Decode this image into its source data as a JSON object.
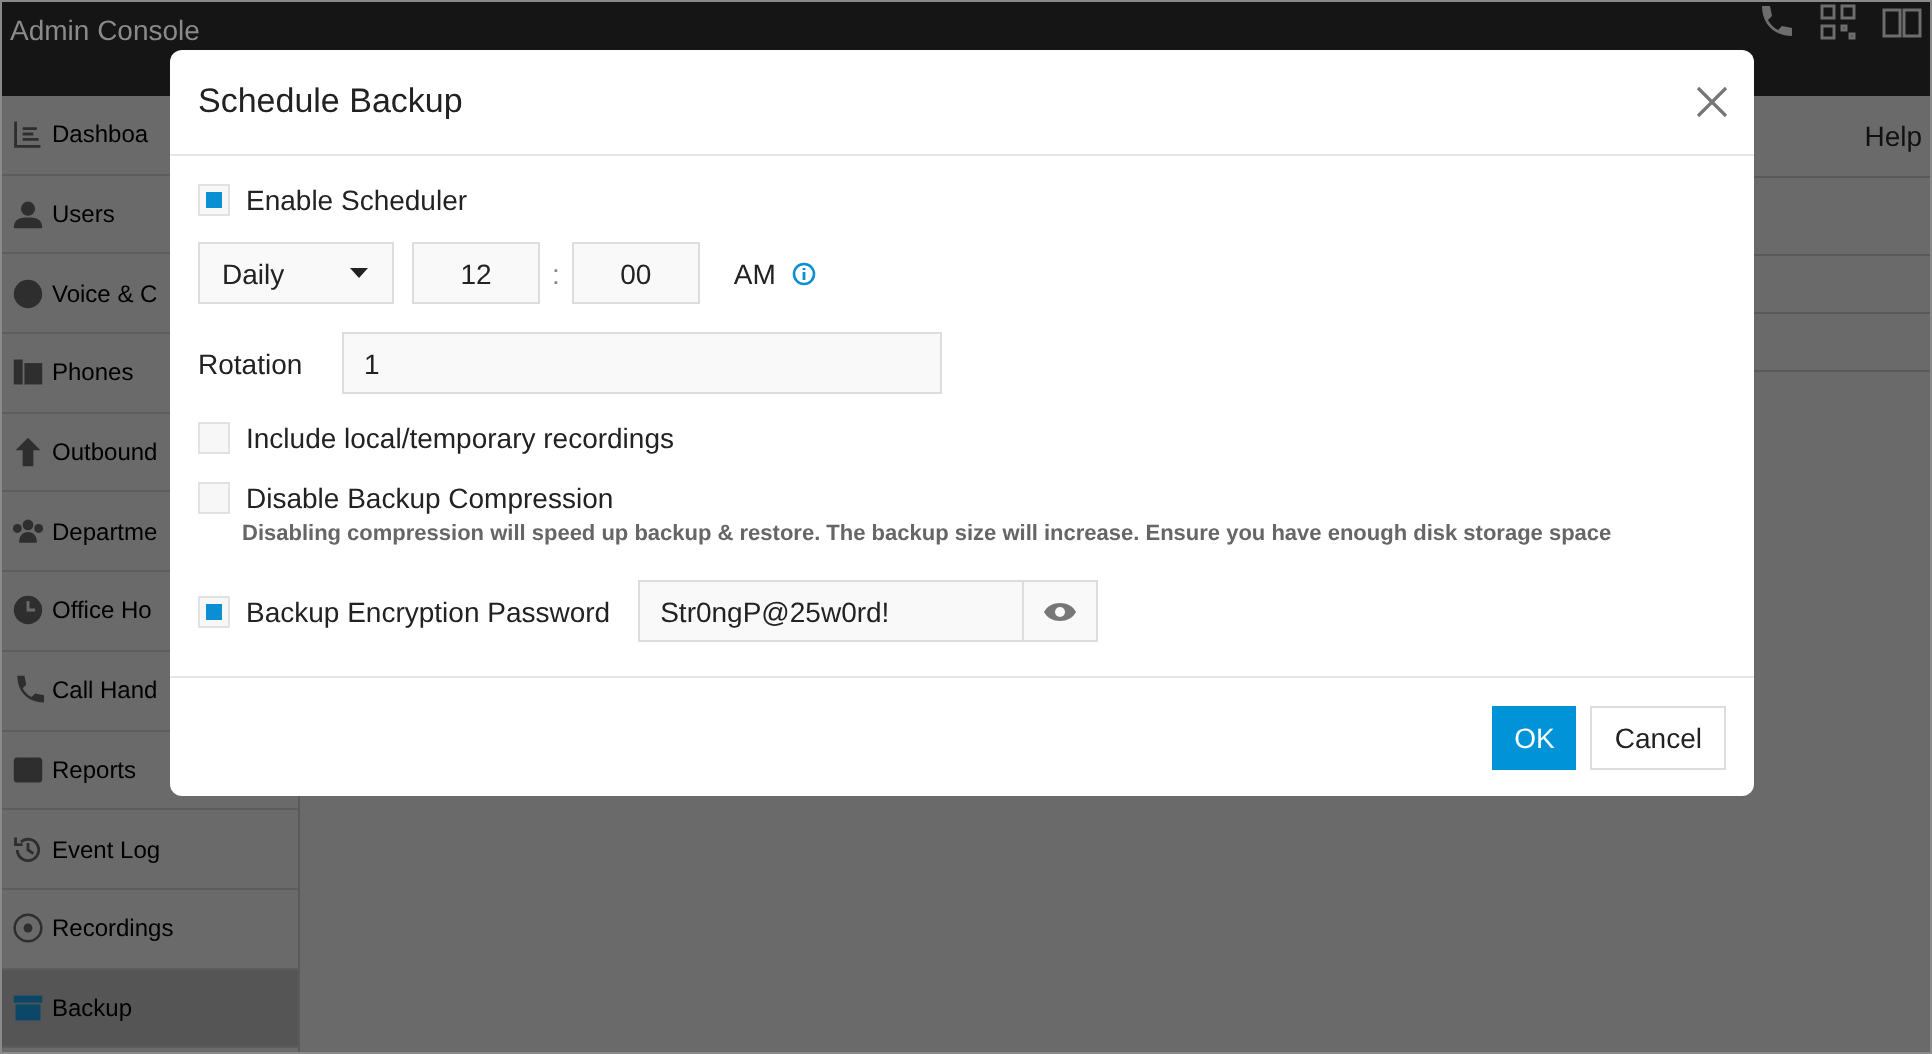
{
  "header": {
    "title": "Admin Console"
  },
  "help": "Help",
  "sidebar": {
    "items": [
      {
        "label": "Dashboa",
        "selected": false
      },
      {
        "label": "Users",
        "selected": false
      },
      {
        "label": "Voice & C",
        "selected": false
      },
      {
        "label": "Phones",
        "selected": false
      },
      {
        "label": "Outbound",
        "selected": false
      },
      {
        "label": "Departme",
        "selected": false
      },
      {
        "label": "Office Ho",
        "selected": false
      },
      {
        "label": "Call Hand",
        "selected": false
      },
      {
        "label": "Reports",
        "selected": false
      },
      {
        "label": "Event Log",
        "selected": false
      },
      {
        "label": "Recordings",
        "selected": false
      },
      {
        "label": "Backup",
        "selected": true
      }
    ]
  },
  "dialog": {
    "title": "Schedule Backup",
    "enable_scheduler": {
      "label": "Enable Scheduler",
      "checked": true
    },
    "schedule": {
      "frequency": "Daily",
      "hour": "12",
      "separator": ":",
      "minute": "00",
      "period": "AM"
    },
    "rotation": {
      "label": "Rotation",
      "value": "1"
    },
    "options": [
      {
        "label": "Include local/temporary recordings",
        "checked": false
      },
      {
        "label": "Disable Backup Compression",
        "checked": false,
        "hint": "Disabling compression will speed up backup & restore. The backup size will increase. Ensure you have enough disk storage space"
      }
    ],
    "encryption": {
      "label": "Backup Encryption Password",
      "checked": true,
      "password": "Str0ngP@25w0rd!"
    },
    "buttons": [
      {
        "label": "OK",
        "kind": "primary"
      },
      {
        "label": "Cancel",
        "kind": "secondary"
      }
    ]
  }
}
